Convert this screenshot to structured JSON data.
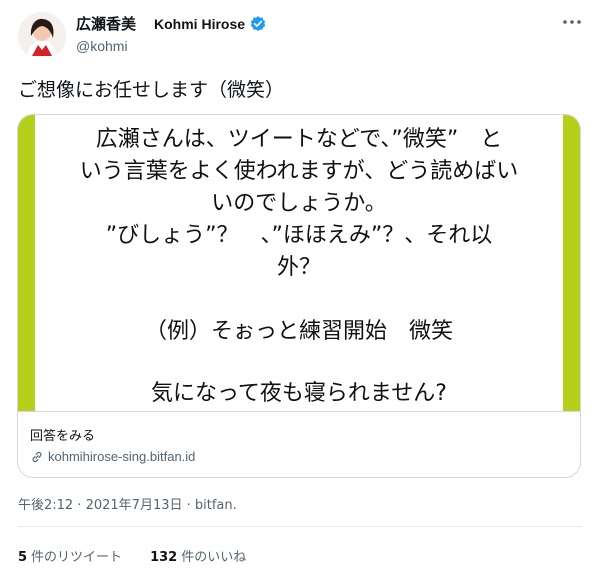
{
  "author": {
    "name_jp": "広瀬香美",
    "name_en": "Kohmi Hirose",
    "handle": "@kohmi",
    "verified": true,
    "avatar_icon": "avatar-icon"
  },
  "tweet": {
    "text": "ご想像にお任せします（微笑）"
  },
  "card": {
    "image_text": [
      "広瀬さんは、ツイートなどで、”微笑”　と",
      "いう言葉をよく使われますが、どう読めばい",
      "いのでしょうか。",
      "”びしょう”？　、”ほほえみ”？、それ以",
      "外？",
      "",
      "（例）そぉっと練習開始　微笑",
      "",
      "気になって夜も寝られません?"
    ],
    "title": "回答をみる",
    "link": "kohmihirose-sing.bitfan.id",
    "accent_color": "#b6cf1b"
  },
  "timestamp": "午後2:12 · 2021年7月13日 · bitfan.",
  "stats": {
    "retweets_count": "5",
    "retweets_label": "件のリツイート",
    "likes_count": "132",
    "likes_label": "件のいいね"
  },
  "colors": {
    "text": "#0f1419",
    "secondary": "#536471",
    "verified": "#1d9bf0"
  }
}
